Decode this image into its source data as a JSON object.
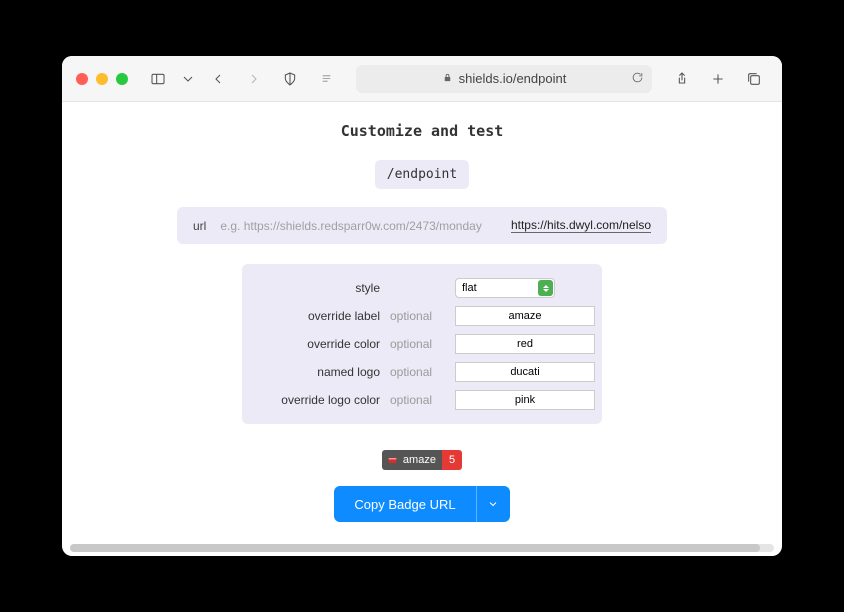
{
  "browser": {
    "address": "shields.io/endpoint"
  },
  "page_title": "Customize and test",
  "endpoint_label": "/endpoint",
  "url_row": {
    "label": "url",
    "placeholder": "e.g. https://shields.redsparr0w.com/2473/monday",
    "value": "https://hits.dwyl.com/nelso"
  },
  "options": {
    "style": {
      "label": "style",
      "value": "flat"
    },
    "override_label": {
      "label": "override label",
      "hint": "optional",
      "value": "amaze"
    },
    "override_color": {
      "label": "override color",
      "hint": "optional",
      "value": "red"
    },
    "named_logo": {
      "label": "named logo",
      "hint": "optional",
      "value": "ducati"
    },
    "override_logo_color": {
      "label": "override logo color",
      "hint": "optional",
      "value": "pink"
    }
  },
  "badge": {
    "label": "amaze",
    "message": "5",
    "color": "#e53935",
    "label_color": "#555"
  },
  "copy_button": "Copy Badge URL"
}
